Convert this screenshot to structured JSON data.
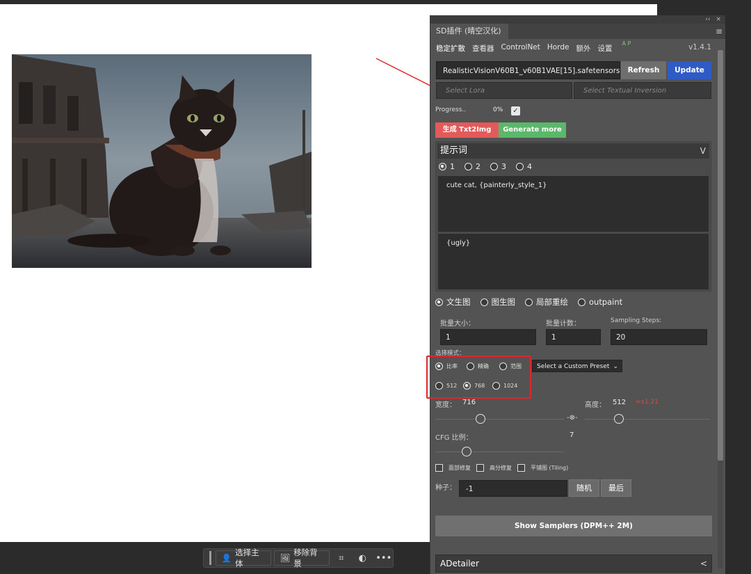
{
  "panel": {
    "title": "SD插件 (晴空汉化)",
    "top_controls": [
      "‹‹",
      "×"
    ],
    "menu_glyph": "≡",
    "nav": [
      "稳定扩散",
      "查看器",
      "ControlNet",
      "Horde",
      "额外",
      "设置"
    ],
    "nav_badge": "A P",
    "version": "v1.4.1"
  },
  "model": {
    "selected": "RealisticVisionV60B1_v60B1VAE[15].safetensors [fe...",
    "refresh_label": "Refresh",
    "update_label": "Update"
  },
  "lora": {
    "placeholder": "Select Lora"
  },
  "textual_inversion": {
    "placeholder": "Select Textual Inversion"
  },
  "progress": {
    "label": "Progress..",
    "value": "0%",
    "checked": true
  },
  "buttons": {
    "generate": "生成 Txt2Img",
    "generate_more": "Generate more"
  },
  "prompt": {
    "header": "提示词",
    "slots": [
      "1",
      "2",
      "3",
      "4"
    ],
    "selected_slot": "1",
    "positive": "cute cat, {painterly_style_1}",
    "negative": "{ugly}"
  },
  "modes": [
    "文生图",
    "图生图",
    "局部重绘",
    "outpaint"
  ],
  "selected_mode": "文生图",
  "batch": {
    "size_label": "批量大小：",
    "size_value": "1",
    "count_label": "批量计数：",
    "count_value": "1",
    "steps_label": "Sampling Steps:",
    "steps_value": "20"
  },
  "select_mode": {
    "label": "选择模式：",
    "ratio_options": [
      "比率",
      "精确",
      "范围"
    ],
    "ratio_selected": "比率",
    "size_options": [
      "512",
      "768",
      "1024"
    ],
    "size_selected": "768",
    "preset_placeholder": "Select a Custom Preset"
  },
  "dimensions": {
    "width_label": "宽度：",
    "width_value": "716",
    "height_label": "高度：",
    "height_value": "512",
    "ratio_text": "≈x1.21",
    "ratio_color": "#e04848",
    "link_glyph": "-⊗-"
  },
  "cfg": {
    "label": "CFG 比例：",
    "value": "7"
  },
  "options": [
    "面部修复",
    "高分修复",
    "平铺图 (Tiling)"
  ],
  "seed": {
    "label": "种子：",
    "value": "-1",
    "random_label": "随机",
    "last_label": "最后"
  },
  "samplers_button": "Show Samplers (DPM++ 2M)",
  "adetailer": {
    "label": "ADetailer",
    "chevron": "<"
  },
  "taskbar": {
    "select_subject": "选择主体",
    "remove_bg": "移除背景",
    "more": "•••"
  },
  "colors": {
    "panel_bg": "#535353",
    "generate_red": "#e35a5a",
    "generate_more_green": "#5bb86a",
    "update_blue": "#2f5cc4",
    "annotation_red": "#e0262a"
  }
}
